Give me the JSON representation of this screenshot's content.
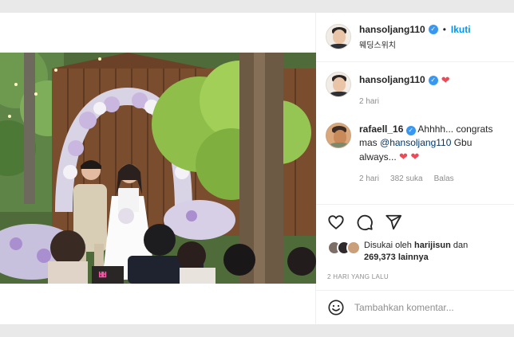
{
  "post": {
    "author": "hansoljang110",
    "follow_label": "Ikuti",
    "location": "웨딩스위치"
  },
  "caption": {
    "author": "hansoljang110",
    "heart": "❤",
    "time": "2 hari"
  },
  "comment": {
    "author": "rafaell_16",
    "text_start": "Ahhhh... congrats mas",
    "mention": "@hansoljang110",
    "text_end": " Gbu always...",
    "hearts": "❤ ❤",
    "time": "2 hari",
    "likes": "382 suka",
    "reply_label": "Balas"
  },
  "likes": {
    "prefix": "Disukai oleh",
    "liker": "harijisun",
    "connector": "dan",
    "count": "269,373",
    "suffix": "lainnya"
  },
  "date_label": "2 HARI YANG LALU",
  "add_comment": {
    "placeholder": "Tambahkan komentar..."
  },
  "colors": {
    "link": "#0095f6",
    "verified": "#3897f0",
    "heart": "#ed4956",
    "muted": "#8e8e8e"
  },
  "icons": [
    "heart-outline-icon",
    "comment-icon",
    "share-icon",
    "emoji-icon",
    "verified-badge-icon"
  ]
}
